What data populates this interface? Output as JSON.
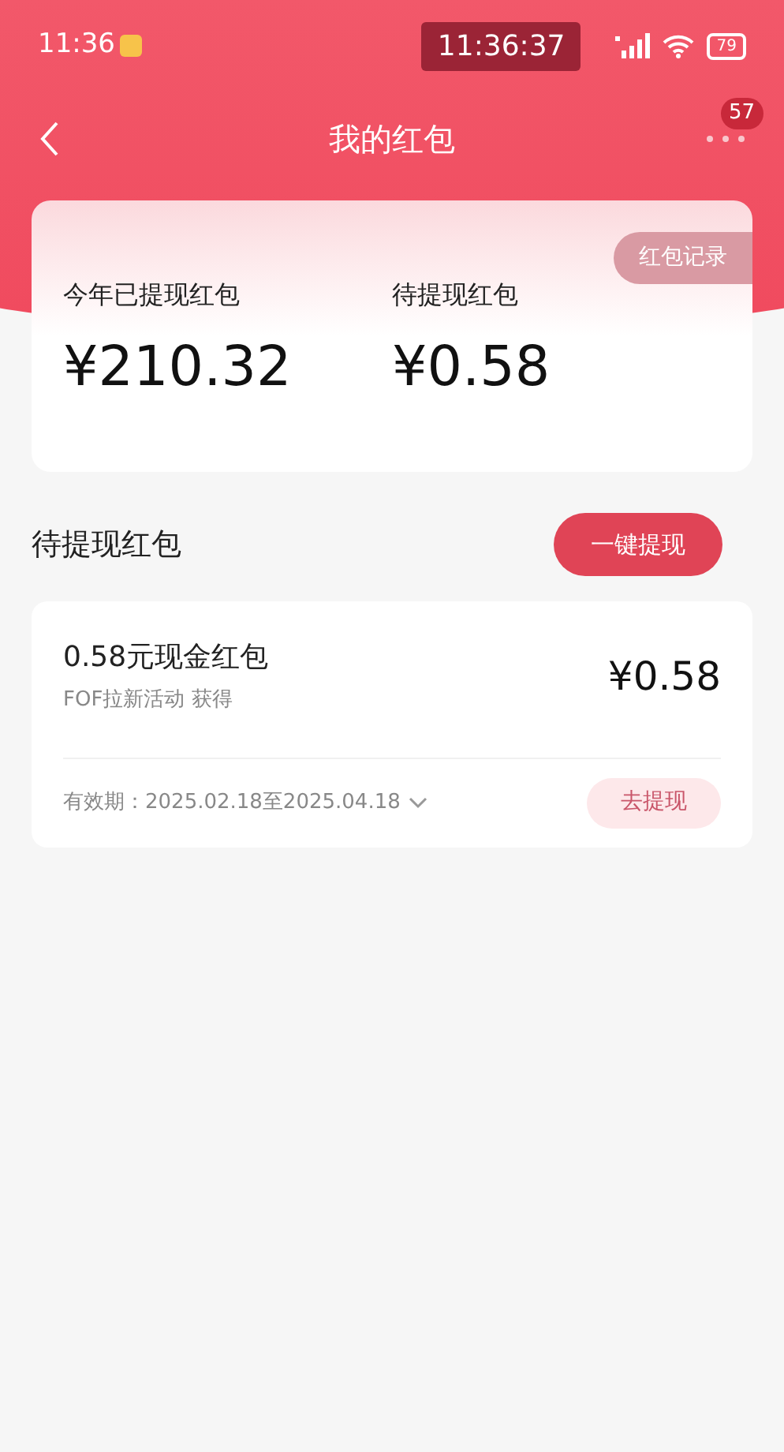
{
  "status_bar": {
    "time": "11:36",
    "clock": "11:36:37",
    "battery": "79"
  },
  "nav": {
    "title": "我的红包",
    "badge": "57"
  },
  "summary": {
    "record_button": "红包记录",
    "stats": [
      {
        "label": "今年已提现红包",
        "amount": "¥210.32"
      },
      {
        "label": "待提现红包",
        "amount": "¥0.58"
      }
    ]
  },
  "section": {
    "title": "待提现红包",
    "action": "一键提现"
  },
  "packets": [
    {
      "title": "0.58元现金红包",
      "source": "FOF拉新活动 获得",
      "amount": "¥0.58",
      "validity": "有效期：2025.02.18至2025.04.18",
      "button": "去提现"
    }
  ]
}
